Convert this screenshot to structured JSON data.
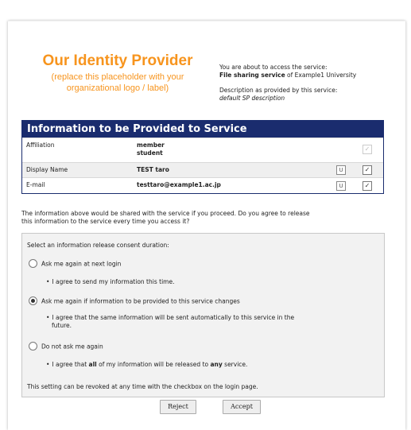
{
  "logo": {
    "title": "Our Identity Provider",
    "subtitle_line1": "(replace this placeholder with your",
    "subtitle_line2": "organizational logo / label)"
  },
  "service": {
    "intro": "You are about to access the service:",
    "name": "File sharing service",
    "of_text": " of Example1 University",
    "desc_label": "Description as provided by this service:",
    "desc_value": "default SP description"
  },
  "table": {
    "header": "Information to be Provided to Service",
    "rows": [
      {
        "label": "Affiliation",
        "value_line1": "member",
        "value_line2": "student",
        "u": "",
        "check": "✓"
      },
      {
        "label": "Display Name",
        "value_line1": "TEST taro",
        "value_line2": "",
        "u": "U",
        "check": "✓"
      },
      {
        "label": "E-mail",
        "value_line1": "testtaro@example1.ac.jp",
        "value_line2": "",
        "u": "U",
        "check": "✓"
      }
    ]
  },
  "question": {
    "line1": "The information above would be shared with the service if you proceed. Do you agree to release",
    "line2": "this information to the service every time you access it?"
  },
  "consent": {
    "title": "Select an information release consent duration:",
    "options": [
      {
        "label": "Ask me again at next login",
        "selected": false,
        "bullet_pre": "I agree to send my information this time.",
        "bullet_bold": "",
        "bullet_post": ""
      },
      {
        "label": "Ask me again if information to be provided to this service changes",
        "selected": true,
        "bullet_pre": "I agree that the same information will be sent automatically to this service in the",
        "bullet_bold": "",
        "bullet_post": "future."
      },
      {
        "label": "Do not ask me again",
        "selected": false,
        "bullet_pre": "I agree that ",
        "bullet_bold": "all",
        "bullet_post": " of my information will be released to ",
        "bullet_bold2": "any",
        "bullet_post2": " service."
      }
    ],
    "revoke": "This setting can be revoked at any time with the checkbox on the login page."
  },
  "buttons": {
    "reject": "Reject",
    "accept": "Accept"
  }
}
